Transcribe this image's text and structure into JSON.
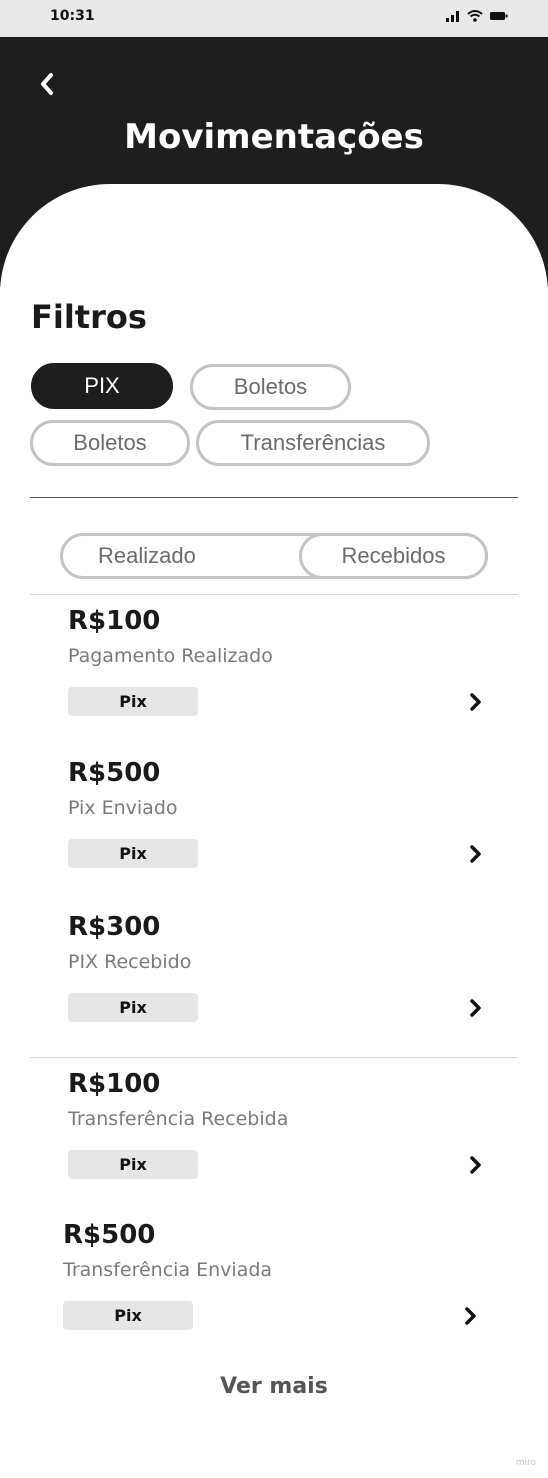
{
  "status_bar": {
    "time": "10:31"
  },
  "header": {
    "title": "Movimentações"
  },
  "filters": {
    "title": "Filtros",
    "chips": [
      {
        "label": "PIX",
        "active": true
      },
      {
        "label": "Boletos",
        "active": false
      },
      {
        "label": "Boletos",
        "active": false
      },
      {
        "label": "Transferências",
        "active": false
      }
    ]
  },
  "toggle": {
    "options": [
      "Realizado",
      "Recebidos"
    ]
  },
  "transactions": [
    {
      "amount": "R$100",
      "description": "Pagamento Realizado",
      "tag": "Pix"
    },
    {
      "amount": "R$500",
      "description": "Pix Enviado",
      "tag": "Pix"
    },
    {
      "amount": "R$300",
      "description": "PIX Recebido",
      "tag": "Pix"
    },
    {
      "amount": "R$100",
      "description": "Transferência Recebida",
      "tag": "Pix"
    },
    {
      "amount": "R$500",
      "description": "Transferência Enviada",
      "tag": "Pix"
    }
  ],
  "footer": {
    "see_more": "Ver mais",
    "watermark": "miro"
  },
  "colors": {
    "header_bg": "#1e1e1e",
    "chip_active_bg": "#1e1e1e",
    "tag_bg": "#e6e6e6"
  },
  "icons": [
    "signal-icon",
    "wifi-icon",
    "battery-icon",
    "back-arrow-icon",
    "chevron-right-icon"
  ]
}
